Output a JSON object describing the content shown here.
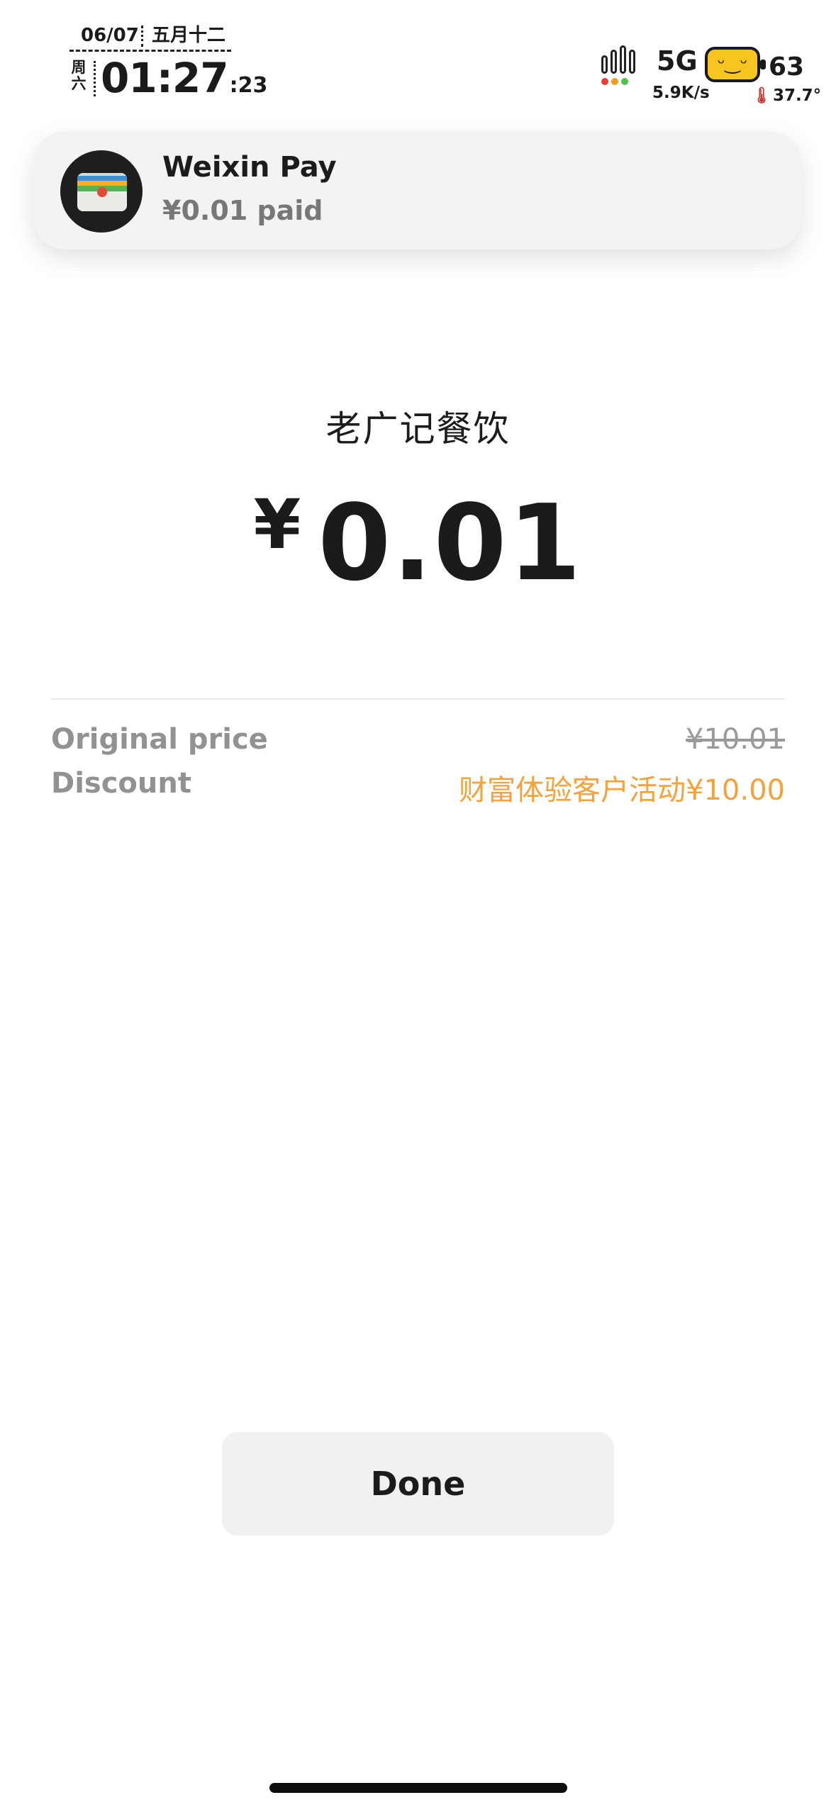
{
  "status_bar": {
    "date": "06/07",
    "lunar_date": "五月十二",
    "weekday": "周六",
    "time": "01:27",
    "seconds": ":23",
    "network": "5G",
    "net_speed": "5.9K/s",
    "battery_level": "63",
    "battery_temp": "37.7°",
    "icons": [
      "signal-icon",
      "battery-face-icon",
      "thermometer-icon"
    ]
  },
  "notification": {
    "app_name": "Weixin Pay",
    "message": "¥0.01 paid",
    "icon": "wallet-icon"
  },
  "payment": {
    "merchant": "老广记餐饮",
    "currency": "¥",
    "amount": "0.01",
    "original_price_label": "Original price",
    "original_price": "¥10.01",
    "discount_label": "Discount",
    "discount_value": "财富体验客户活动¥10.00"
  },
  "actions": {
    "done_label": "Done"
  },
  "colors": {
    "discount_orange": "#f3a23c",
    "muted_gray": "#929292",
    "button_bg": "#f1f1f1",
    "battery_yellow": "#f7c520"
  }
}
